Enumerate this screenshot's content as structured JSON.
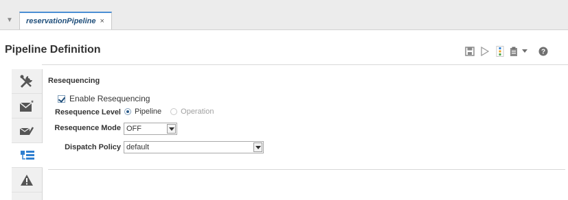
{
  "tabs": {
    "menu_icon": "chevron-down-icon",
    "active_label": "reservationPipeline",
    "close_glyph": "×"
  },
  "header": {
    "title": "Pipeline Definition",
    "toolbar_icons": [
      "save-icon",
      "run-icon",
      "pipeline-step-icon",
      "clipboard-icon",
      "dropdown-icon",
      "help-icon"
    ]
  },
  "vertical_nav": {
    "items": [
      "tools-icon",
      "envelope-new-icon",
      "envelope-edit-icon",
      "resequencing-icon",
      "warning-icon"
    ],
    "active_index": 3
  },
  "section": {
    "title": "Resequencing",
    "enable_label": "Enable Resequencing",
    "enable_checked": true
  },
  "form": {
    "level_label": "Resequence Level",
    "level_options": [
      "Pipeline",
      "Operation"
    ],
    "level_selected": "Pipeline",
    "mode_label": "Resequence Mode",
    "mode_value": "OFF",
    "policy_label": "Dispatch Policy",
    "policy_value": "default"
  },
  "colors": {
    "accent": "#4a8ed4",
    "tab_text": "#1f4e7a",
    "disabled": "#a0a0a0"
  }
}
